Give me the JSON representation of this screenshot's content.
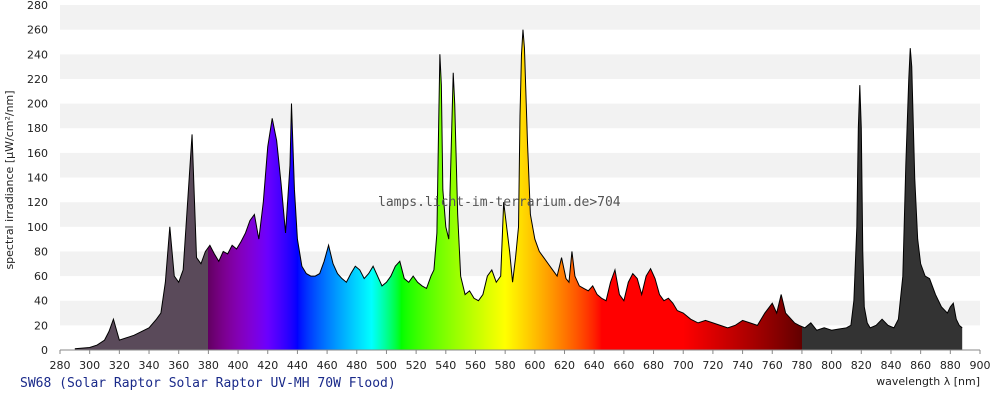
{
  "caption": "SW68 (Solar Raptor Solar Raptor UV-MH 70W Flood)",
  "chart_data": {
    "type": "area",
    "title": "",
    "xlabel": "wavelength λ [nm]",
    "ylabel": "spectral irradiance [µW/cm²/nm]",
    "watermark": "lamps.licht-im-terrarium.de>704",
    "xlim": [
      280,
      900
    ],
    "ylim": [
      0,
      280
    ],
    "xticks": [
      280,
      300,
      320,
      340,
      360,
      380,
      400,
      420,
      440,
      460,
      480,
      500,
      520,
      540,
      560,
      580,
      600,
      620,
      640,
      660,
      680,
      700,
      720,
      740,
      760,
      780,
      800,
      820,
      840,
      860,
      880,
      900
    ],
    "yticks": [
      0,
      20,
      40,
      60,
      80,
      100,
      120,
      140,
      160,
      180,
      200,
      220,
      240,
      260,
      280
    ],
    "grid": "horizontal bands",
    "colors": {
      "uv": "#5a4a5a",
      "ir": "#333333",
      "band_light": "#f2f2f2",
      "band_dark": "#ffffff"
    },
    "x": [
      290,
      300,
      305,
      310,
      313,
      316,
      320,
      330,
      340,
      345,
      348,
      351,
      354,
      357,
      360,
      363,
      366,
      369,
      372,
      375,
      378,
      381,
      384,
      387,
      390,
      393,
      396,
      399,
      402,
      405,
      408,
      411,
      414,
      417,
      420,
      423,
      426,
      429,
      432,
      435,
      436,
      438,
      440,
      443,
      446,
      449,
      452,
      455,
      458,
      461,
      464,
      467,
      470,
      473,
      476,
      479,
      482,
      485,
      488,
      491,
      494,
      497,
      500,
      503,
      506,
      509,
      512,
      515,
      518,
      521,
      524,
      527,
      530,
      532,
      534,
      535,
      536,
      537,
      538,
      540,
      542,
      544,
      545,
      546,
      548,
      550,
      553,
      556,
      559,
      562,
      565,
      568,
      571,
      574,
      577,
      578,
      579,
      581,
      583,
      585,
      587,
      589,
      590,
      591,
      592,
      593,
      595,
      597,
      600,
      603,
      606,
      609,
      612,
      615,
      618,
      621,
      623,
      625,
      627,
      630,
      633,
      636,
      639,
      642,
      645,
      648,
      651,
      654,
      657,
      660,
      663,
      666,
      669,
      672,
      675,
      678,
      681,
      684,
      687,
      690,
      693,
      696,
      700,
      705,
      710,
      715,
      720,
      725,
      730,
      735,
      740,
      745,
      750,
      755,
      760,
      763,
      766,
      769,
      772,
      775,
      778,
      782,
      786,
      790,
      795,
      800,
      805,
      810,
      813,
      815,
      817,
      818,
      819,
      820,
      821,
      822,
      824,
      826,
      830,
      834,
      838,
      842,
      845,
      848,
      850,
      852,
      853,
      854,
      856,
      858,
      860,
      863,
      866,
      870,
      874,
      878,
      880,
      882,
      884,
      886,
      888
    ],
    "y": [
      1,
      2,
      4,
      8,
      15,
      25,
      8,
      12,
      18,
      25,
      30,
      55,
      100,
      60,
      55,
      65,
      120,
      175,
      75,
      70,
      80,
      85,
      78,
      72,
      80,
      78,
      85,
      82,
      88,
      95,
      105,
      110,
      90,
      120,
      165,
      188,
      170,
      135,
      95,
      150,
      200,
      130,
      90,
      68,
      62,
      60,
      60,
      62,
      72,
      85,
      70,
      62,
      58,
      55,
      62,
      68,
      65,
      58,
      62,
      68,
      60,
      52,
      55,
      60,
      68,
      72,
      58,
      55,
      60,
      55,
      52,
      50,
      60,
      65,
      95,
      170,
      240,
      215,
      130,
      100,
      90,
      180,
      225,
      200,
      110,
      60,
      45,
      48,
      42,
      40,
      45,
      60,
      65,
      55,
      60,
      90,
      120,
      100,
      80,
      55,
      75,
      100,
      190,
      240,
      260,
      245,
      170,
      110,
      90,
      80,
      75,
      70,
      65,
      60,
      75,
      58,
      55,
      80,
      60,
      52,
      50,
      48,
      52,
      45,
      42,
      40,
      55,
      65,
      45,
      40,
      55,
      62,
      58,
      45,
      60,
      66,
      58,
      45,
      40,
      42,
      38,
      32,
      30,
      25,
      22,
      24,
      22,
      20,
      18,
      20,
      24,
      22,
      20,
      30,
      38,
      30,
      45,
      30,
      26,
      22,
      20,
      18,
      22,
      16,
      18,
      16,
      17,
      18,
      20,
      40,
      100,
      180,
      215,
      180,
      80,
      35,
      22,
      18,
      20,
      25,
      20,
      18,
      25,
      60,
      150,
      220,
      245,
      230,
      140,
      90,
      70,
      60,
      58,
      45,
      35,
      30,
      35,
      38,
      25,
      20,
      18
    ]
  }
}
